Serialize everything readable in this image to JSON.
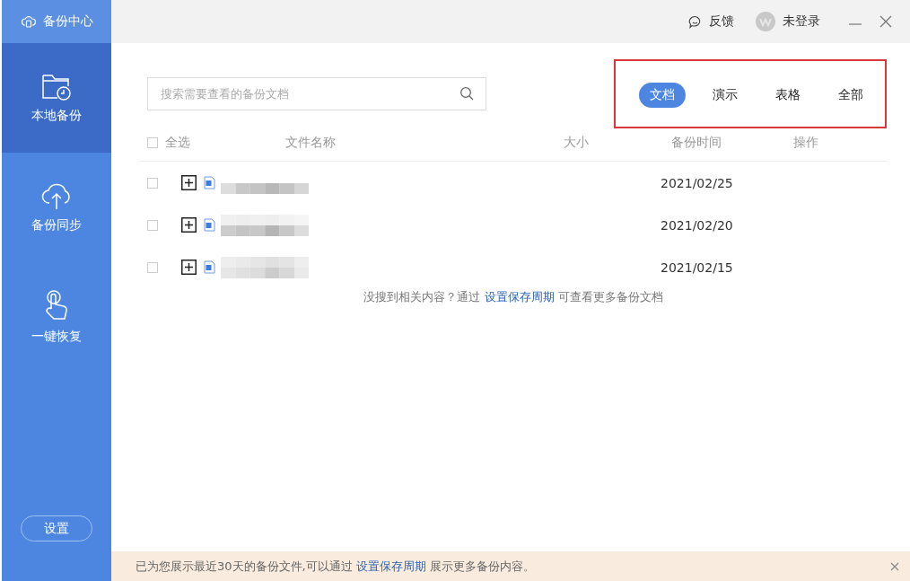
{
  "app": {
    "title": "备份中心"
  },
  "nav": [
    {
      "label": "本地备份",
      "kind": "local",
      "selected": true
    },
    {
      "label": "备份同步",
      "kind": "sync",
      "selected": false
    },
    {
      "label": "一键恢复",
      "kind": "restore",
      "selected": false
    }
  ],
  "settings_button": "设置",
  "top_bar": {
    "feedback": "反馈",
    "account": "未登录"
  },
  "search": {
    "placeholder": "搜索需要查看的备份文档"
  },
  "tabs": [
    {
      "label": "文档",
      "selected": true
    },
    {
      "label": "演示",
      "selected": false
    },
    {
      "label": "表格",
      "selected": false
    },
    {
      "label": "全部",
      "selected": false
    }
  ],
  "table": {
    "select_all": {
      "label": "全选",
      "checked": false
    },
    "columns": [
      "文件名称",
      "大小",
      "备份时间",
      "操作"
    ],
    "rows": [
      {
        "checked": false,
        "time": "2021/02/25"
      },
      {
        "checked": false,
        "time": "2021/02/20"
      },
      {
        "checked": false,
        "time": "2021/02/15"
      }
    ]
  },
  "hint": {
    "before": "没搜到相关内容？通过",
    "link": "设置保存周期",
    "after": "可查看更多备份文档"
  },
  "banner": {
    "before": "已为您展示最近30天的备份文件,可以通过",
    "link": "设置保存周期",
    "after": "展示更多备份内容。"
  }
}
